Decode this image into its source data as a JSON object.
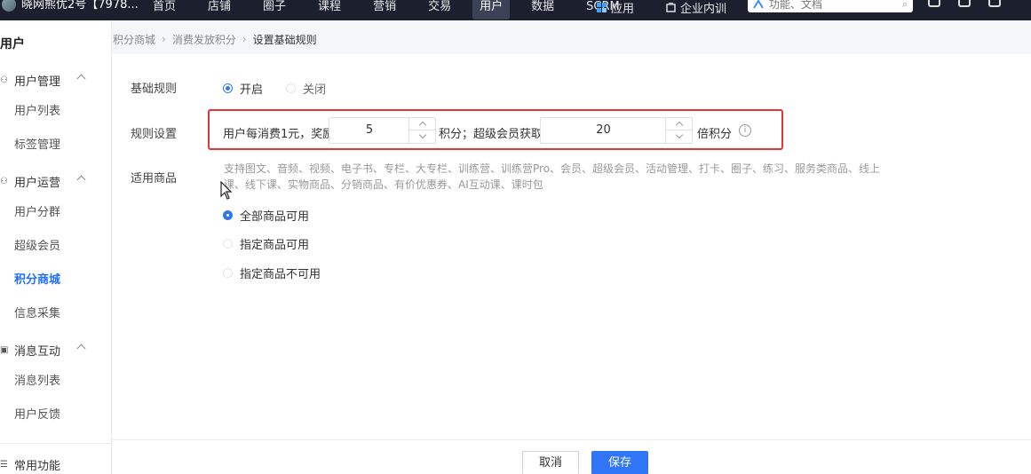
{
  "topbar": {
    "shop_name": "晓网熊优2号【7978...",
    "nav": [
      "首页",
      "店铺",
      "圈子",
      "课程",
      "营销",
      "交易",
      "用户",
      "数据",
      "SCRM"
    ],
    "active_nav": "用户",
    "right_nav": [
      "应用",
      "企业内训"
    ],
    "search_placeholder": "功能、文档"
  },
  "sidebar": {
    "title": "用户",
    "groups": [
      {
        "label": "用户管理",
        "items": [
          "用户列表",
          "标签管理"
        ]
      },
      {
        "label": "用户运营",
        "items": [
          "用户分群",
          "超级会员",
          "积分商城",
          "信息采集"
        ]
      },
      {
        "label": "消息互动",
        "items": [
          "消息列表",
          "用户反馈"
        ]
      },
      {
        "label": "常用功能",
        "items": []
      }
    ],
    "active_item": "积分商城"
  },
  "breadcrumb": [
    "积分商城",
    "消费发放积分",
    "设置基础规则"
  ],
  "form": {
    "basic_rule": {
      "label": "基础规则",
      "options": [
        "开启",
        "关闭"
      ],
      "selected": "开启"
    },
    "rule_setting": {
      "label": "规则设置",
      "text_prefix": "用户每消费1元，奖励",
      "points_value": "5",
      "text_middle": "积分；超级会员获取",
      "multiplier_value": "20",
      "text_suffix": "倍积分",
      "info_icon": "info-icon"
    },
    "applicable_goods": {
      "label": "适用商品",
      "support_text": "支持图文、音频、视频、电子书、专栏、大专栏、训练营、训练营Pro、会员、超级会员、活动管理、打卡、圈子、练习、服务类商品、线上课、线下课、实物商品、分销商品、有价优惠券、AI互动课、课时包",
      "options": [
        "全部商品可用",
        "指定商品可用",
        "指定商品不可用"
      ],
      "selected": "全部商品可用"
    }
  },
  "footer": {
    "cancel_label": "取消",
    "save_label": "保存"
  },
  "colors": {
    "accent": "#2f75f6",
    "highlight_border": "#e53535",
    "topbar_bg": "#1b1f2e"
  }
}
